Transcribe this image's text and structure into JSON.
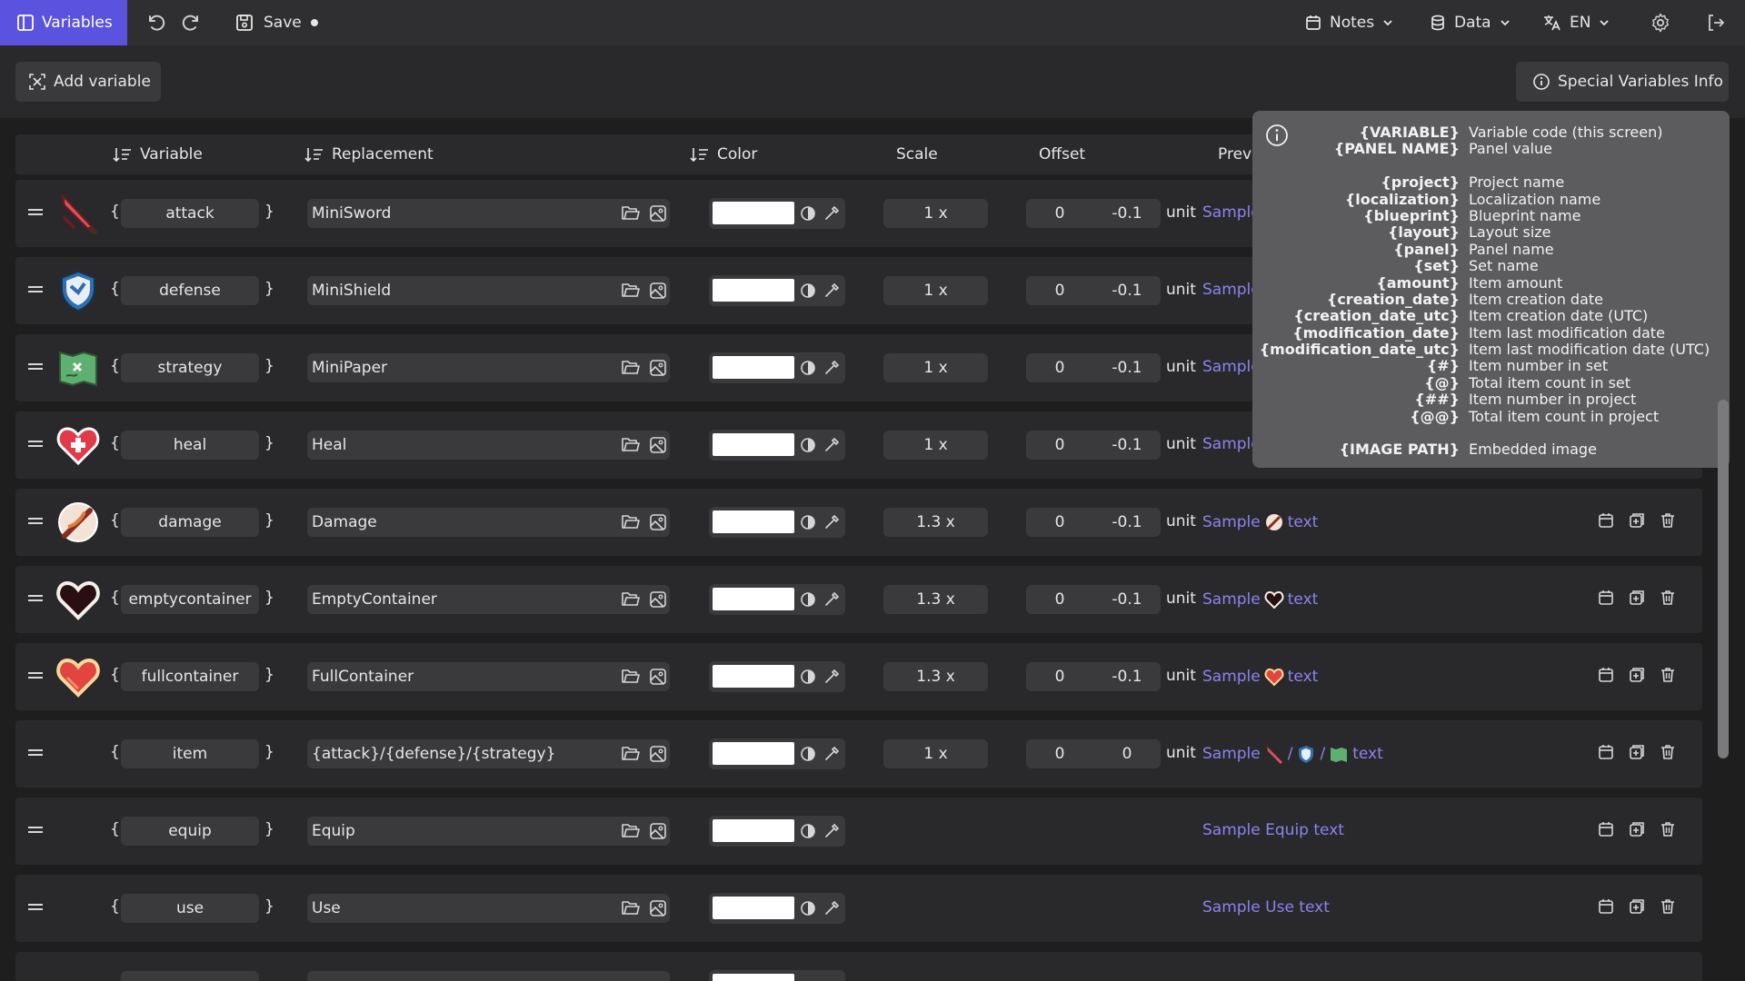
{
  "topbar": {
    "tab_label": "Variables",
    "save_label": "Save",
    "notes_label": "Notes",
    "data_label": "Data",
    "lang_label": "EN"
  },
  "toolbar": {
    "add_variable": "Add variable",
    "special_info": "Special Variables Info"
  },
  "table": {
    "headers": {
      "variable": "Variable",
      "replacement": "Replacement",
      "color": "Color",
      "scale": "Scale",
      "offset": "Offset",
      "preview": "Previ"
    },
    "rows": [
      {
        "name": "attack",
        "replacement": "MiniSword",
        "scale": "1 x",
        "off_x": "0",
        "off_y": "-0.1",
        "unit": "unit",
        "prev_a": "Sample",
        "prev_b": "",
        "icon": "sword-icon"
      },
      {
        "name": "defense",
        "replacement": "MiniShield",
        "scale": "1 x",
        "off_x": "0",
        "off_y": "-0.1",
        "unit": "unit",
        "prev_a": "Sample",
        "prev_b": "",
        "icon": "shield-icon"
      },
      {
        "name": "strategy",
        "replacement": "MiniPaper",
        "scale": "1 x",
        "off_x": "0",
        "off_y": "-0.1",
        "unit": "unit",
        "prev_a": "Sample",
        "prev_b": "",
        "icon": "map-icon"
      },
      {
        "name": "heal",
        "replacement": "Heal",
        "scale": "1 x",
        "off_x": "0",
        "off_y": "-0.1",
        "unit": "unit",
        "prev_a": "Sample",
        "prev_b": "",
        "icon": "heal-heart-icon"
      },
      {
        "name": "damage",
        "replacement": "Damage",
        "scale": "1.3 x",
        "off_x": "0",
        "off_y": "-0.1",
        "unit": "unit",
        "prev_a": "Sample",
        "prev_b": "text",
        "icon": "damage-icon"
      },
      {
        "name": "emptycontainer",
        "replacement": "EmptyContainer",
        "scale": "1.3 x",
        "off_x": "0",
        "off_y": "-0.1",
        "unit": "unit",
        "prev_a": "Sample",
        "prev_b": "text",
        "icon": "empty-heart-icon"
      },
      {
        "name": "fullcontainer",
        "replacement": "FullContainer",
        "scale": "1.3 x",
        "off_x": "0",
        "off_y": "-0.1",
        "unit": "unit",
        "prev_a": "Sample",
        "prev_b": "text",
        "icon": "full-heart-icon"
      },
      {
        "name": "item",
        "replacement": "{attack}/{defense}/{strategy}",
        "scale": "1 x",
        "off_x": "0",
        "off_y": "0",
        "unit": "unit",
        "prev_a": "Sample",
        "prev_b": "text",
        "prev_sep": "/",
        "icon": ""
      },
      {
        "name": "equip",
        "replacement": "Equip",
        "prev_full": "Sample Equip text",
        "icon": ""
      },
      {
        "name": "use",
        "replacement": "Use",
        "prev_full": "Sample Use text",
        "icon": ""
      }
    ]
  },
  "tooltip": {
    "rows": [
      {
        "k": "{VARIABLE}",
        "v": "Variable code (this screen)"
      },
      {
        "k": "{PANEL NAME}",
        "v": "Panel value"
      },
      {
        "k": "",
        "v": ""
      },
      {
        "k": "{project}",
        "v": "Project name"
      },
      {
        "k": "{localization}",
        "v": "Localization name"
      },
      {
        "k": "{blueprint}",
        "v": "Blueprint name"
      },
      {
        "k": "{layout}",
        "v": "Layout size"
      },
      {
        "k": "{panel}",
        "v": "Panel name"
      },
      {
        "k": "{set}",
        "v": "Set name"
      },
      {
        "k": "{amount}",
        "v": "Item amount"
      },
      {
        "k": "{creation_date}",
        "v": "Item creation date"
      },
      {
        "k": "{creation_date_utc}",
        "v": "Item creation date (UTC)"
      },
      {
        "k": "{modification_date}",
        "v": "Item last modification date"
      },
      {
        "k": "{modification_date_utc}",
        "v": "Item last modification date (UTC)"
      },
      {
        "k": "{#}",
        "v": "Item number in set"
      },
      {
        "k": "{@}",
        "v": "Total item count in set"
      },
      {
        "k": "{##}",
        "v": "Item number in project"
      },
      {
        "k": "{@@}",
        "v": "Total item count in project"
      },
      {
        "k": "",
        "v": ""
      },
      {
        "k": "{IMAGE PATH}",
        "v": "Embedded image"
      }
    ]
  },
  "colors": {
    "accent": "#5b53e0",
    "preview_link": "#8a84f0",
    "row_bg": "#29292b",
    "field_bg": "#3a3a3c",
    "tooltip_bg": "#5c5c5e"
  }
}
